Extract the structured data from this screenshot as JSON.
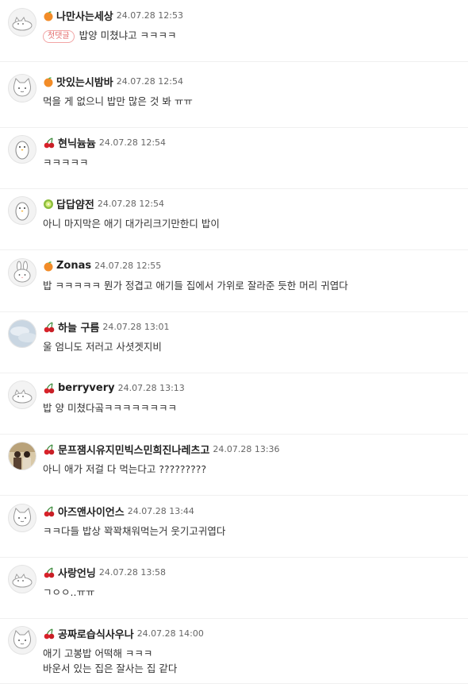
{
  "colors": {
    "accent_reply": "#e36b6b",
    "date": "#666666",
    "text": "#333333"
  },
  "comments": [
    {
      "nickname": "나만사는세상",
      "badge": "orange",
      "date": "24.07.28 12:53",
      "reply_tag": "첫댓글",
      "lines": [
        "밥양 미쳤냐고 ㅋㅋㅋㅋ"
      ],
      "avatar": "cat-lying-icon"
    },
    {
      "nickname": "맛있는시밤바",
      "badge": "orange",
      "date": "24.07.28 12:54",
      "reply_tag": "",
      "lines": [
        "먹을 게 없으니 밥만 많은 것 봐 ㅠㅠ"
      ],
      "avatar": "cat-face-icon"
    },
    {
      "nickname": "현닉늄늄",
      "badge": "cherry",
      "date": "24.07.28 12:54",
      "reply_tag": "",
      "lines": [
        "ㅋㅋㅋㅋㅋ"
      ],
      "avatar": "penguin-icon"
    },
    {
      "nickname": "답답얌전",
      "badge": "kiwi",
      "date": "24.07.28 12:54",
      "reply_tag": "",
      "lines": [
        "아니 마지막은 애기 대가리크기만한디 밥이"
      ],
      "avatar": "penguin-icon"
    },
    {
      "nickname": "Zonas",
      "badge": "orange",
      "date": "24.07.28 12:55",
      "reply_tag": "",
      "lines": [
        "밥 ㅋㅋㅋㅋㅋ 뭔가 정겹고 애기들 집에서 가위로 잘라준 듯한 머리 귀엽다"
      ],
      "avatar": "rabbit-icon"
    },
    {
      "nickname": "하늘 구름",
      "badge": "cherry",
      "date": "24.07.28 13:01",
      "reply_tag": "",
      "lines": [
        "울 엄니도 저러고 사셧겟지비"
      ],
      "avatar": "sky-photo-icon"
    },
    {
      "nickname": "berryvery",
      "badge": "cherry",
      "date": "24.07.28 13:13",
      "reply_tag": "",
      "lines": [
        "밥 양 미쳤다곸ㅋㅋㅋㅋㅋㅋㅋㅋ"
      ],
      "avatar": "cat-lying-icon"
    },
    {
      "nickname": "문프잼시유지민빅스민희진나레츠고",
      "badge": "cherry",
      "date": "24.07.28 13:36",
      "reply_tag": "",
      "lines": [
        "아니 애가 저걸 다 먹는다고 ?????????"
      ],
      "avatar": "people-photo-icon"
    },
    {
      "nickname": "아즈앤사이언스",
      "badge": "cherry",
      "date": "24.07.28 13:44",
      "reply_tag": "",
      "lines": [
        "ㅋㅋ다들 밥상 꽉꽉채워먹는거 웃기고귀엽다"
      ],
      "avatar": "cat-face-icon"
    },
    {
      "nickname": "사랑언닝",
      "badge": "cherry",
      "date": "24.07.28 13:58",
      "reply_tag": "",
      "lines": [
        "ㄱㅇㅇ..ㅠㅠ"
      ],
      "avatar": "cat-lying-icon"
    },
    {
      "nickname": "공짜로습식사우나",
      "badge": "cherry",
      "date": "24.07.28 14:00",
      "reply_tag": "",
      "lines": [
        "애기 고봉밥 어떡해 ㅋㅋㅋ",
        "바운서 있는 집은 잘사는 집 같다"
      ],
      "avatar": "cat-face-icon"
    }
  ]
}
